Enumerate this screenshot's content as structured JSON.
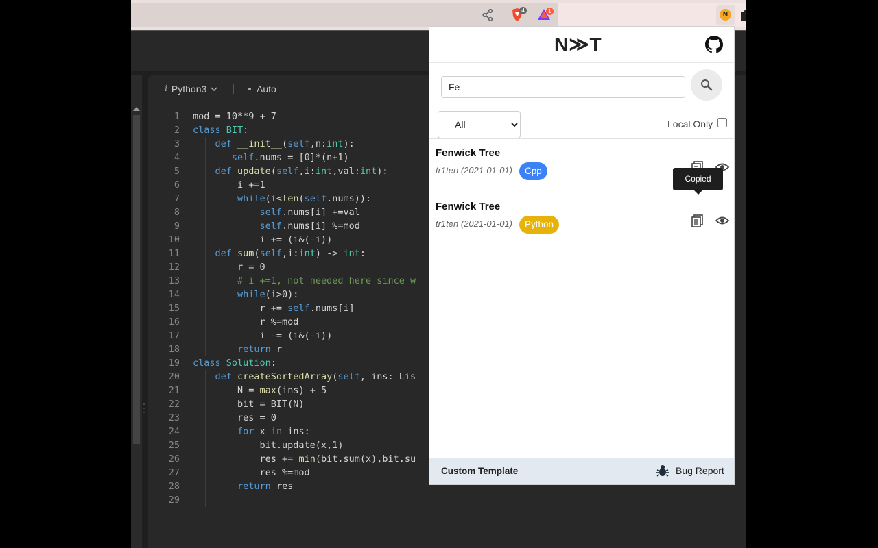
{
  "colors": {
    "tag_cpp": "#3b82f6",
    "tag_python": "#e7b30b",
    "accent_keyword": "#569cd6"
  },
  "editor": {
    "language": "Python3",
    "mode": "Auto",
    "lines": [
      [
        [
          "mod = 10**9 + 7",
          "n"
        ]
      ],
      [
        [
          "class ",
          "k"
        ],
        [
          "BIT",
          "t"
        ],
        [
          ":",
          "n"
        ]
      ],
      [
        [
          "    ",
          "n"
        ],
        [
          "def ",
          "k"
        ],
        [
          "__init__",
          "f"
        ],
        [
          "(",
          "n"
        ],
        [
          "self",
          "k"
        ],
        [
          ",n:",
          "n"
        ],
        [
          "int",
          "t"
        ],
        [
          "):",
          "n"
        ]
      ],
      [
        [
          "       ",
          "n"
        ],
        [
          "self",
          "k"
        ],
        [
          ".nums = [0]*(n+1)",
          "n"
        ]
      ],
      [
        [
          "    ",
          "n"
        ],
        [
          "def ",
          "k"
        ],
        [
          "update",
          "f"
        ],
        [
          "(",
          "n"
        ],
        [
          "self",
          "k"
        ],
        [
          ",i:",
          "n"
        ],
        [
          "int",
          "t"
        ],
        [
          ",val:",
          "n"
        ],
        [
          "int",
          "t"
        ],
        [
          "):",
          "n"
        ]
      ],
      [
        [
          "        i +=1",
          "n"
        ]
      ],
      [
        [
          "        ",
          "n"
        ],
        [
          "while",
          "k"
        ],
        [
          "(i<",
          "n"
        ],
        [
          "len",
          "f"
        ],
        [
          "(",
          "n"
        ],
        [
          "self",
          "k"
        ],
        [
          ".nums)):",
          "n"
        ]
      ],
      [
        [
          "            ",
          "n"
        ],
        [
          "self",
          "k"
        ],
        [
          ".nums[i] +=val",
          "n"
        ]
      ],
      [
        [
          "            ",
          "n"
        ],
        [
          "self",
          "k"
        ],
        [
          ".nums[i] %=mod",
          "n"
        ]
      ],
      [
        [
          "            i += (i&(-i))",
          "n"
        ]
      ],
      [
        [
          "    ",
          "n"
        ],
        [
          "def ",
          "k"
        ],
        [
          "sum",
          "f"
        ],
        [
          "(",
          "n"
        ],
        [
          "self",
          "k"
        ],
        [
          ",i:",
          "n"
        ],
        [
          "int",
          "t"
        ],
        [
          ") -> ",
          "n"
        ],
        [
          "int",
          "t"
        ],
        [
          ":",
          "n"
        ]
      ],
      [
        [
          "        r = 0",
          "n"
        ]
      ],
      [
        [
          "        ",
          "n"
        ],
        [
          "# i +=1, not needed here since w",
          "c"
        ]
      ],
      [
        [
          "        ",
          "n"
        ],
        [
          "while",
          "k"
        ],
        [
          "(i>0):",
          "n"
        ]
      ],
      [
        [
          "            r += ",
          "n"
        ],
        [
          "self",
          "k"
        ],
        [
          ".nums[i]",
          "n"
        ]
      ],
      [
        [
          "            r %=mod",
          "n"
        ]
      ],
      [
        [
          "            i -= (i&(-i))",
          "n"
        ]
      ],
      [
        [
          "        ",
          "n"
        ],
        [
          "return ",
          "k"
        ],
        [
          "r",
          "n"
        ]
      ],
      [
        [
          "class ",
          "k"
        ],
        [
          "Solution",
          "t"
        ],
        [
          ":",
          "n"
        ]
      ],
      [
        [
          "    ",
          "n"
        ],
        [
          "def ",
          "k"
        ],
        [
          "createSortedArray",
          "f"
        ],
        [
          "(",
          "n"
        ],
        [
          "self",
          "k"
        ],
        [
          ", ins: Lis",
          "n"
        ]
      ],
      [
        [
          "        N = ",
          "n"
        ],
        [
          "max",
          "f"
        ],
        [
          "(ins) + 5",
          "n"
        ]
      ],
      [
        [
          "        bit = BIT(N)",
          "n"
        ]
      ],
      [
        [
          "        res = 0",
          "n"
        ]
      ],
      [
        [
          "        ",
          "n"
        ],
        [
          "for ",
          "k"
        ],
        [
          "x ",
          "n"
        ],
        [
          "in ",
          "k"
        ],
        [
          "ins:",
          "n"
        ]
      ],
      [
        [
          "            bit.update(x,1)",
          "n"
        ]
      ],
      [
        [
          "            res += ",
          "n"
        ],
        [
          "min",
          "f"
        ],
        [
          "(bit.sum(x),bit.su",
          "n"
        ]
      ],
      [
        [
          "            res %=mod",
          "n"
        ]
      ],
      [
        [
          "        ",
          "n"
        ],
        [
          "return ",
          "k"
        ],
        [
          "res",
          "n"
        ]
      ],
      [
        [
          "",
          "n"
        ]
      ]
    ]
  },
  "browser": {
    "brave_badge": "4",
    "rewards_badge": "1"
  },
  "popup": {
    "logo": "N≫T",
    "search": {
      "value": "Fe",
      "placeholder": ""
    },
    "filter": {
      "selected": "All"
    },
    "local_only_label": "Local Only",
    "results": [
      {
        "title": "Fenwick Tree",
        "meta": "tr1ten (2021-01-01)",
        "tag": "Cpp"
      },
      {
        "title": "Fenwick Tree",
        "meta": "tr1ten (2021-01-01)",
        "tag": "Python"
      }
    ],
    "tooltip": "Copied",
    "footer": {
      "custom_template": "Custom Template",
      "bug_report": "Bug Report"
    }
  }
}
